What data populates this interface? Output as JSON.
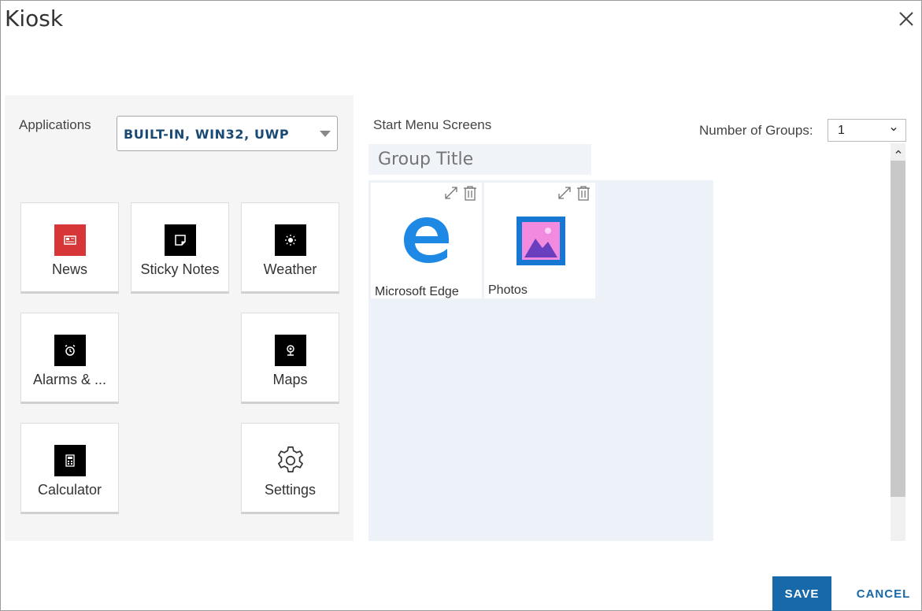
{
  "dialog": {
    "title": "Kiosk",
    "close_icon": "close-icon"
  },
  "applications": {
    "label": "Applications",
    "selected": "BUILT-IN, WIN32, UWP",
    "tiles": [
      {
        "label": "News",
        "icon": "news-icon",
        "color": "#d63637"
      },
      {
        "label": "Sticky Notes",
        "icon": "sticky-notes-icon",
        "color": "#000000"
      },
      {
        "label": "Weather",
        "icon": "weather-icon",
        "color": "#000000"
      },
      {
        "label": "Alarms & ...",
        "icon": "alarm-clock-icon",
        "color": "#000000"
      },
      {
        "label": "Maps",
        "icon": "maps-icon",
        "color": "#000000"
      },
      {
        "label": "Calculator",
        "icon": "calculator-icon",
        "color": "#000000"
      },
      {
        "label": "Settings",
        "icon": "gear-icon",
        "color": "#ffffff"
      }
    ]
  },
  "start_menu": {
    "label": "Start Menu Screens",
    "number_of_groups_label": "Number of Groups:",
    "number_of_groups_value": "1",
    "group_title_placeholder": "Group Title",
    "pinned": [
      {
        "label": "Microsoft Edge",
        "icon": "edge-icon",
        "color": "#1e88e5"
      },
      {
        "label": "Photos",
        "icon": "photos-icon",
        "color": "#1778d4"
      }
    ]
  },
  "footer": {
    "save_label": "SAVE",
    "cancel_label": "CANCEL"
  },
  "colors": {
    "primary": "#1769aa",
    "panel_bg": "#f5f5f5",
    "group_bg": "#edf2f8"
  }
}
